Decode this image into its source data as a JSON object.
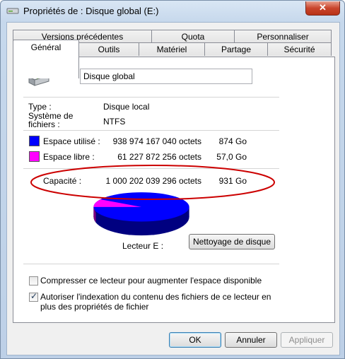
{
  "window": {
    "title": "Propriétés de : Disque global (E:)",
    "close_label": "✕"
  },
  "tabs_row1": [
    {
      "label": "Versions précédentes"
    },
    {
      "label": "Quota"
    },
    {
      "label": "Personnaliser"
    }
  ],
  "tabs_row2": [
    {
      "label": "Général",
      "active": true
    },
    {
      "label": "Outils"
    },
    {
      "label": "Matériel"
    },
    {
      "label": "Partage"
    },
    {
      "label": "Sécurité"
    }
  ],
  "general": {
    "volume_name": "Disque global",
    "type_label": "Type :",
    "type_value": "Disque local",
    "fs_label": "Système de fichiers :",
    "fs_value": "NTFS",
    "used": {
      "label": "Espace utilisé :",
      "bytes": "938 974 167 040 octets",
      "size": "874 Go",
      "color": "#0000ff"
    },
    "free": {
      "label": "Espace libre :",
      "bytes": "61 227 872 256 octets",
      "size": "57,0 Go",
      "color": "#ff00ff"
    },
    "capacity": {
      "label": "Capacité :",
      "bytes": "1 000 202 039 296 octets",
      "size": "931 Go"
    },
    "drive_label": "Lecteur E :",
    "cleanup_button": "Nettoyage de disque",
    "compress_label": "Compresser ce lecteur pour augmenter l'espace disponible",
    "compress_checked": false,
    "index_label": "Autoriser l'indexation du contenu des fichiers de ce lecteur en plus des propriétés de fichier",
    "index_checked": true
  },
  "footer": {
    "ok": "OK",
    "cancel": "Annuler",
    "apply": "Appliquer"
  },
  "colors": {
    "annotation_ellipse": "#cc0000",
    "used_pie": "#0000ff",
    "free_pie": "#ff00ff"
  }
}
